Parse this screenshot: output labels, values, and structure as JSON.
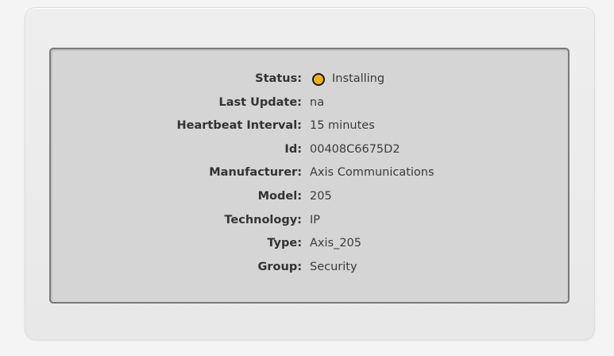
{
  "device": {
    "status_color": "#f2b01e",
    "fields": [
      {
        "label": "Status:",
        "value": "Installing",
        "icon": "status-circle-icon"
      },
      {
        "label": "Last Update:",
        "value": "na"
      },
      {
        "label": "Heartbeat Interval:",
        "value": "15 minutes"
      },
      {
        "label": "Id:",
        "value": "00408C6675D2"
      },
      {
        "label": "Manufacturer:",
        "value": "Axis Communications"
      },
      {
        "label": "Model:",
        "value": "205"
      },
      {
        "label": "Technology:",
        "value": "IP"
      },
      {
        "label": "Type:",
        "value": "Axis_205"
      },
      {
        "label": "Group:",
        "value": "Security"
      }
    ]
  }
}
